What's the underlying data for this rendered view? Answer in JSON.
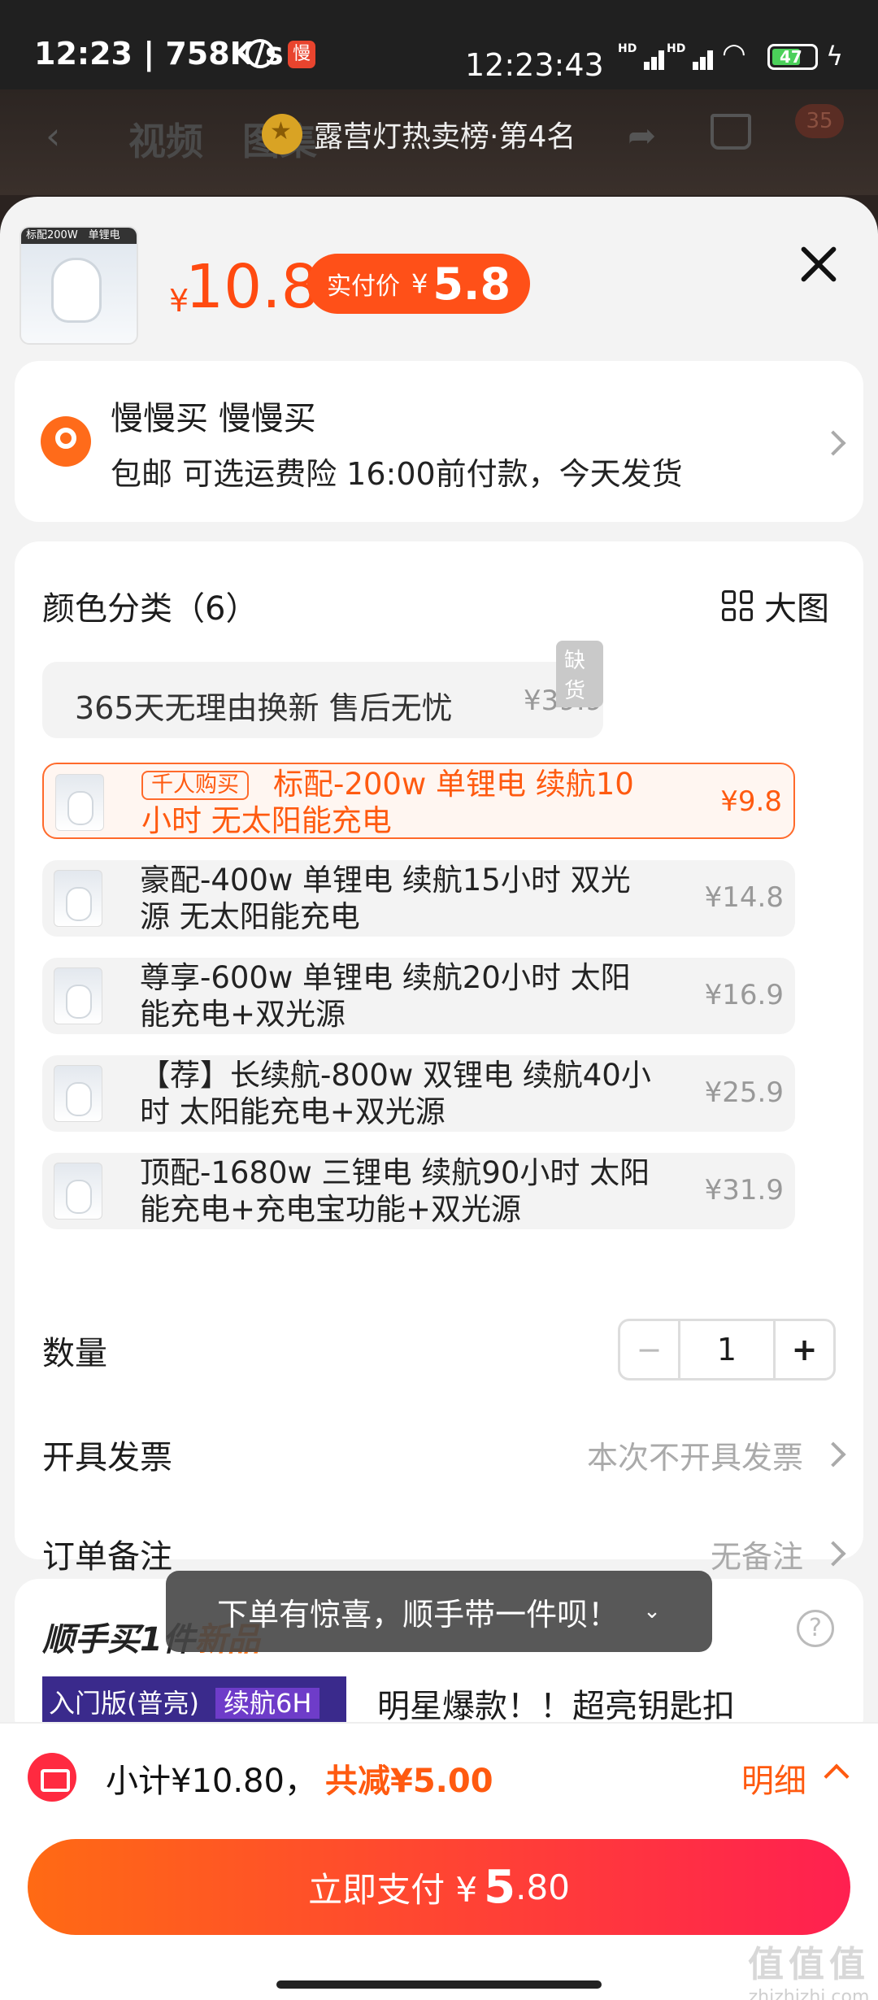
{
  "status": {
    "time": "12:23",
    "speed": "758K/s",
    "clock": "12:23:43",
    "battery": "47",
    "app_badge": "慢",
    "hd": "HD"
  },
  "nav": {
    "tab_video": "视频",
    "tab_image": "图集",
    "rank": "露营灯热卖榜·第4名",
    "cart_count": "35"
  },
  "product": {
    "thumb_tag": "标配200W　单锂电",
    "price_symbol": "¥",
    "price": "10.8",
    "paid_label": "实付价",
    "paid_symbol": "¥",
    "paid_value": "5.8"
  },
  "address": {
    "name": "慢慢买 慢慢买",
    "info": "包邮 可选运费险 16:00前付款，今天发货"
  },
  "options": {
    "title": "颜色分类（6）",
    "big_view": "大图",
    "service": {
      "label": "365天无理由换新 售后无忧",
      "price": "¥39.9",
      "tag": "缺货"
    },
    "items": [
      {
        "hot": "千人购买",
        "label": "标配-200w 单锂电 续航10小时 无太阳能充电",
        "price": "¥9.8"
      },
      {
        "label": "豪配-400w 单锂电 续航15小时 双光源 无太阳能充电",
        "price": "¥14.8"
      },
      {
        "label": "尊享-600w 单锂电 续航20小时 太阳能充电+双光源",
        "price": "¥16.9"
      },
      {
        "label": "【荐】长续航-800w 双锂电 续航40小时 太阳能充电+双光源",
        "price": "¥25.9"
      },
      {
        "label": "顶配-1680w 三锂电 续航90小时 太阳能充电+充电宝功能+双光源",
        "price": "¥31.9"
      }
    ],
    "qty_label": "数量",
    "qty_minus": "−",
    "qty_value": "1",
    "qty_plus": "+",
    "invoice_label": "开具发票",
    "invoice_value": "本次不开具发票",
    "note_label": "订单备注",
    "note_value": "无备注"
  },
  "more": {
    "title": "顺手买1件",
    "title_tag": "新品",
    "banner": "入门版(普亮)",
    "banner_tag": "续航6H",
    "desc": "明星爆款！！超亮钥匙扣",
    "help": "?"
  },
  "toast": {
    "text": "下单有惊喜，顺手带一件呗！",
    "icon": "⌄"
  },
  "bottom": {
    "subtotal": "小计¥10.80，",
    "saving": "共减¥5.00",
    "detail": "明细",
    "pay_label": "立即支付 ¥",
    "pay_int": "5",
    "pay_dec": ".80"
  },
  "watermark": {
    "logo": "值值值",
    "site": "zhizhizhi.com"
  }
}
